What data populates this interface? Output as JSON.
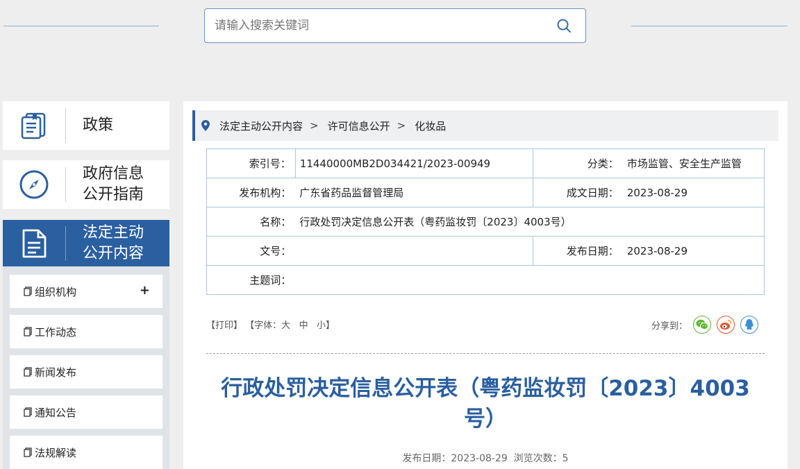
{
  "search": {
    "placeholder": "请输入搜索关键词",
    "icon": "search-icon"
  },
  "nav": {
    "items": [
      {
        "label": "政策",
        "icon": "book-icon"
      },
      {
        "label": "政府信息\n公开指南",
        "icon": "compass-icon"
      },
      {
        "label": "法定主动\n公开内容",
        "icon": "document-icon"
      }
    ],
    "sub": [
      {
        "label": "组织机构",
        "has_plus": "+"
      },
      {
        "label": "工作动态"
      },
      {
        "label": "新闻发布"
      },
      {
        "label": "通知公告"
      },
      {
        "label": "法规解读"
      }
    ]
  },
  "breadcrumb": [
    "法定主动公开内容",
    "许可信息公开",
    "化妆品"
  ],
  "meta": {
    "index_label": "索引号：",
    "index_value": "11440000MB2D034421/2023-00949",
    "category_label": "分类：",
    "category_value": "市场监管、安全生产监管",
    "publisher_label": "发布机构：",
    "publisher_value": "广东省药品监督管理局",
    "created_label": "成文日期：",
    "created_value": "2023-08-29",
    "name_label": "名称：",
    "name_value": "行政处罚决定信息公开表（粤药监妆罚〔2023〕4003号）",
    "doc_no_label": "文号：",
    "doc_no_value": "",
    "pub_date_label": "发布日期：",
    "pub_date_value": "2023-08-29",
    "subject_label": "主题词：",
    "subject_value": ""
  },
  "tools": {
    "print": "【打印】",
    "font_prefix": "【字体：",
    "font_large": "大",
    "font_medium": "中",
    "font_small": "小",
    "font_suffix": "】",
    "share_label": "分享到："
  },
  "article": {
    "title": "行政处罚决定信息公开表（粤药监妆罚〔2023〕4003号）",
    "publish_label": "发布日期：",
    "publish_date": "2023-08-29",
    "views_label": "浏览次数：",
    "views": "5"
  },
  "colors": {
    "accent": "#2a5fa0",
    "wechat": "#5cb531",
    "weibo": "#e6532c",
    "qq": "#3a8fd8"
  }
}
